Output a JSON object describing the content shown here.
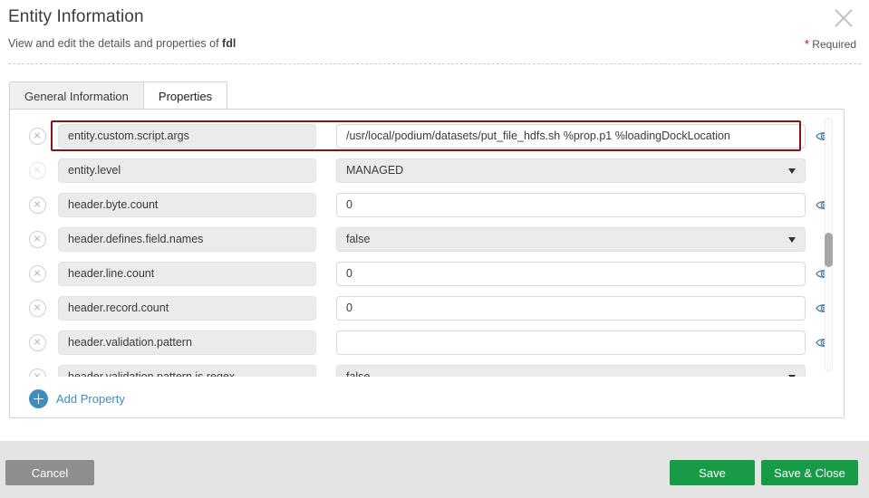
{
  "header": {
    "title": "Entity Information",
    "subtitle_prefix": "View and edit the details and properties of ",
    "subtitle_entity": "fdl",
    "required_star": "*",
    "required_label": "Required",
    "close_icon": "close-icon"
  },
  "tabs": [
    {
      "label": "General Information",
      "active": false
    },
    {
      "label": "Properties",
      "active": true
    }
  ],
  "properties": {
    "rows": [
      {
        "key": "entity.custom.script.args",
        "value": "/usr/local/podium/datasets/put_file_hdfs.sh %prop.p1 %loadingDockLocation",
        "type": "text",
        "eye": true,
        "highlighted": true,
        "delete_faded": false
      },
      {
        "key": "entity.level",
        "value": "MANAGED",
        "type": "select",
        "eye": false,
        "highlighted": false,
        "delete_faded": true
      },
      {
        "key": "header.byte.count",
        "value": "0",
        "type": "text",
        "eye": true,
        "highlighted": false,
        "delete_faded": false
      },
      {
        "key": "header.defines.field.names",
        "value": "false",
        "type": "select",
        "eye": false,
        "highlighted": false,
        "delete_faded": false
      },
      {
        "key": "header.line.count",
        "value": "0",
        "type": "text",
        "eye": true,
        "highlighted": false,
        "delete_faded": false
      },
      {
        "key": "header.record.count",
        "value": "0",
        "type": "text",
        "eye": true,
        "highlighted": false,
        "delete_faded": false
      },
      {
        "key": "header.validation.pattern",
        "value": "",
        "type": "text",
        "eye": true,
        "highlighted": false,
        "delete_faded": false
      },
      {
        "key": "header.validation.pattern.is.regex",
        "value": "false",
        "type": "select",
        "eye": false,
        "highlighted": false,
        "delete_faded": false
      }
    ],
    "add_property_label": "Add Property"
  },
  "footer": {
    "cancel_label": "Cancel",
    "save_label": "Save",
    "save_close_label": "Save & Close"
  },
  "colors": {
    "accent_blue": "#3f8dbd",
    "save_green": "#179b47",
    "required_red": "#d0021b",
    "highlight_red": "#8b1313",
    "cancel_gray": "#8e8e8e"
  }
}
